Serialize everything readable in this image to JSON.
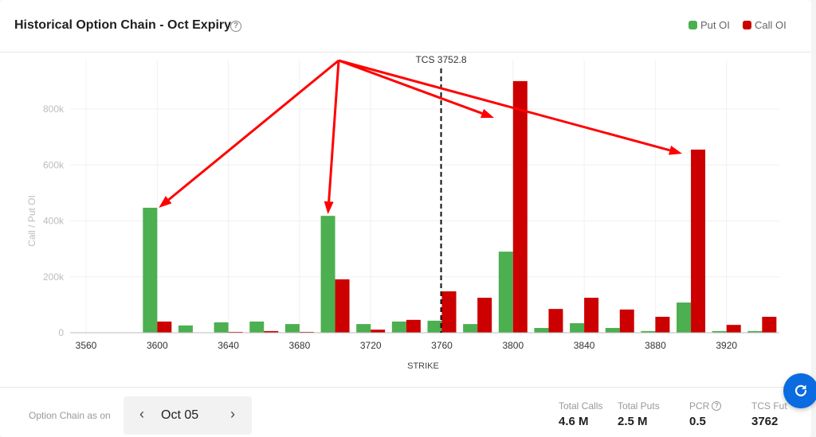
{
  "header": {
    "title": "Historical Option Chain - Oct Expiry",
    "help_icon": "question-circle-icon"
  },
  "legend": {
    "put_label": "Put OI",
    "call_label": "Call OI"
  },
  "colors": {
    "put": "#4caf50",
    "call": "#cc0000",
    "annotation_arrow": "#ff0000",
    "refresh_button": "#0b6be0"
  },
  "chart_data": {
    "type": "bar",
    "title": "Historical Option Chain - Oct Expiry",
    "xlabel": "STRIKE",
    "ylabel": "Call / Put OI",
    "ylim": [
      0,
      900000
    ],
    "yticks": [
      0,
      200000,
      400000,
      600000,
      800000
    ],
    "ytick_labels": [
      "0",
      "200k",
      "400k",
      "600k",
      "800k"
    ],
    "categories": [
      3560,
      3580,
      3600,
      3620,
      3640,
      3660,
      3680,
      3700,
      3720,
      3740,
      3760,
      3780,
      3800,
      3820,
      3840,
      3860,
      3880,
      3900,
      3920,
      3940
    ],
    "xtick_labels": [
      "3560",
      "3600",
      "3640",
      "3680",
      "3720",
      "3760",
      "3800",
      "3840",
      "3880",
      "3920"
    ],
    "series": [
      {
        "name": "Put OI",
        "values": [
          0,
          0,
          447000,
          26000,
          37000,
          40000,
          31000,
          418000,
          31000,
          40000,
          43000,
          31000,
          290000,
          17000,
          34000,
          17000,
          6000,
          108000,
          6000,
          6000
        ]
      },
      {
        "name": "Call OI",
        "values": [
          0,
          0,
          40000,
          0,
          3000,
          6000,
          3000,
          191000,
          11000,
          46000,
          148000,
          125000,
          900000,
          85000,
          125000,
          83000,
          57000,
          655000,
          28000,
          57000
        ]
      }
    ],
    "spot_marker": {
      "label": "TCS 3752.8",
      "value": 3752.8,
      "style": "dashed"
    },
    "grid": true,
    "legend_position": "top-right",
    "annotations": [
      {
        "type": "arrow",
        "target_strike": 3600,
        "target_series": "Put OI"
      },
      {
        "type": "arrow",
        "target_strike": 3700,
        "target_series": "Put OI"
      },
      {
        "type": "arrow",
        "target_strike": 3800,
        "target_series": "Call OI"
      },
      {
        "type": "arrow",
        "target_strike": 3900,
        "target_series": "Call OI"
      }
    ]
  },
  "footer": {
    "as_of_label": "Option Chain as on",
    "date": "Oct 05",
    "prev_icon": "chevron-left-icon",
    "next_icon": "chevron-right-icon",
    "stats": [
      {
        "label": "Total Calls",
        "value": "4.6 M"
      },
      {
        "label": "Total Puts",
        "value": "2.5 M"
      },
      {
        "label": "PCR",
        "value": "0.5",
        "help": true
      },
      {
        "label": "TCS Fut",
        "value": "3762"
      }
    ],
    "refresh_icon": "refresh-icon"
  }
}
